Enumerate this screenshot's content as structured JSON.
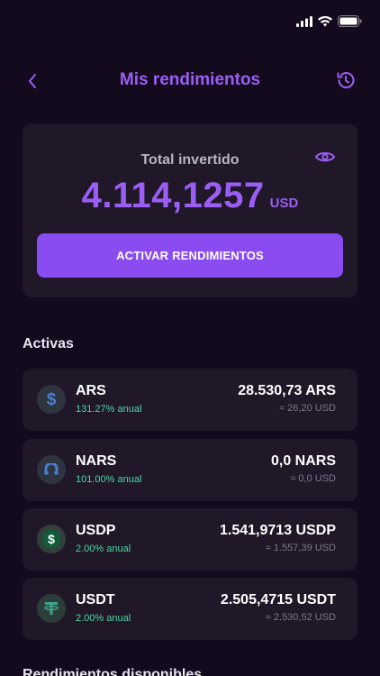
{
  "nav": {
    "title": "Mis rendimientos"
  },
  "summary": {
    "label": "Total invertido",
    "amount": "4.114,1257",
    "unit": "USD",
    "button_label": "ACTIVAR RENDIMIENTOS"
  },
  "active": {
    "section_title": "Activas",
    "items": [
      {
        "name": "ARS",
        "rate": "131.27% anual",
        "balance": "28.530,73 ARS",
        "usd": "≈ 26,20 USD",
        "icon": "peso-icon"
      },
      {
        "name": "NARS",
        "rate": "101.00% anual",
        "balance": "0,0 NARS",
        "usd": "≈ 0,0 USD",
        "icon": "nars-icon"
      },
      {
        "name": "USDP",
        "rate": "2.00% anual",
        "balance": "1.541,9713 USDP",
        "usd": "≈ 1.557,39 USD",
        "icon": "usdp-icon"
      },
      {
        "name": "USDT",
        "rate": "2.00% anual",
        "balance": "2.505,4715 USDT",
        "usd": "≈ 2.530,52 USD",
        "icon": "tether-icon"
      }
    ]
  },
  "available": {
    "section_title": "Rendimientos disponibles"
  },
  "colors": {
    "background": "#130a1e",
    "card": "#201829",
    "accent": "#9b5ef5",
    "button": "#8a4cf0",
    "positive": "#4ed6a5"
  }
}
